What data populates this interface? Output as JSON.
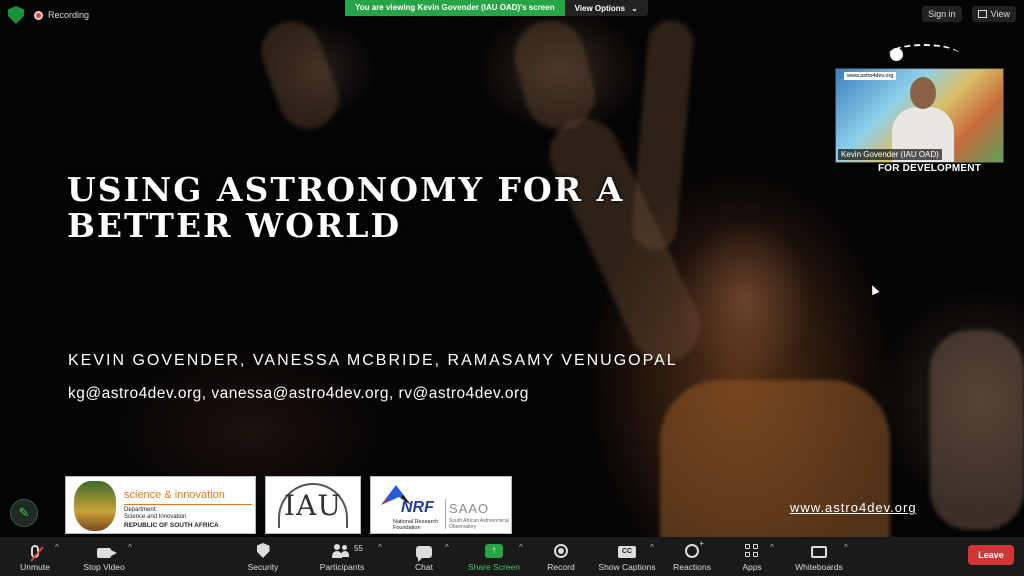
{
  "meeting": {
    "recording_label": "Recording",
    "viewing_banner": "You are viewing Kevin Govender (IAU OAD)'s screen",
    "view_options": "View Options",
    "sign_in": "Sign in",
    "view": "View"
  },
  "slide": {
    "title_line1": "USING ASTRONOMY FOR A",
    "title_line2": "BETTER WORLD",
    "authors": "KEVIN GOVENDER, VANESSA MCBRIDE, RAMASAMY VENUGOPAL",
    "emails": "kg@astro4dev.org, vanessa@astro4dev.org, rv@astro4dev.org",
    "website": "www.astro4dev.org",
    "logos": {
      "sa_title": "science & innovation",
      "sa_line1": "Department:",
      "sa_line2": "Science and Innovation",
      "sa_line3": "REPUBLIC OF SOUTH AFRICA",
      "iau": "IAU",
      "nrf": "NRF",
      "nrf_sub": "National Research Foundation",
      "saao": "SAAO",
      "saao_sub": "South African Astronomical Observatory"
    },
    "for_development": "FOR DEVELOPMENT"
  },
  "video_thumbnail": {
    "participant_name": "Kevin Govender (IAU OAD)",
    "overlay_url": "www.astro4dev.org"
  },
  "toolbar": {
    "unmute": "Unmute",
    "stop_video": "Stop Video",
    "security": "Security",
    "participants": "Participants",
    "participants_count": "55",
    "chat": "Chat",
    "share_screen": "Share Screen",
    "record": "Record",
    "show_captions": "Show Captions",
    "reactions": "Reactions",
    "apps": "Apps",
    "whiteboards": "Whiteboards",
    "leave": "Leave",
    "caret": "^"
  },
  "colors": {
    "green": "#27a445",
    "leave_red": "#d23535",
    "toolbar_bg": "#1a1a1a"
  }
}
